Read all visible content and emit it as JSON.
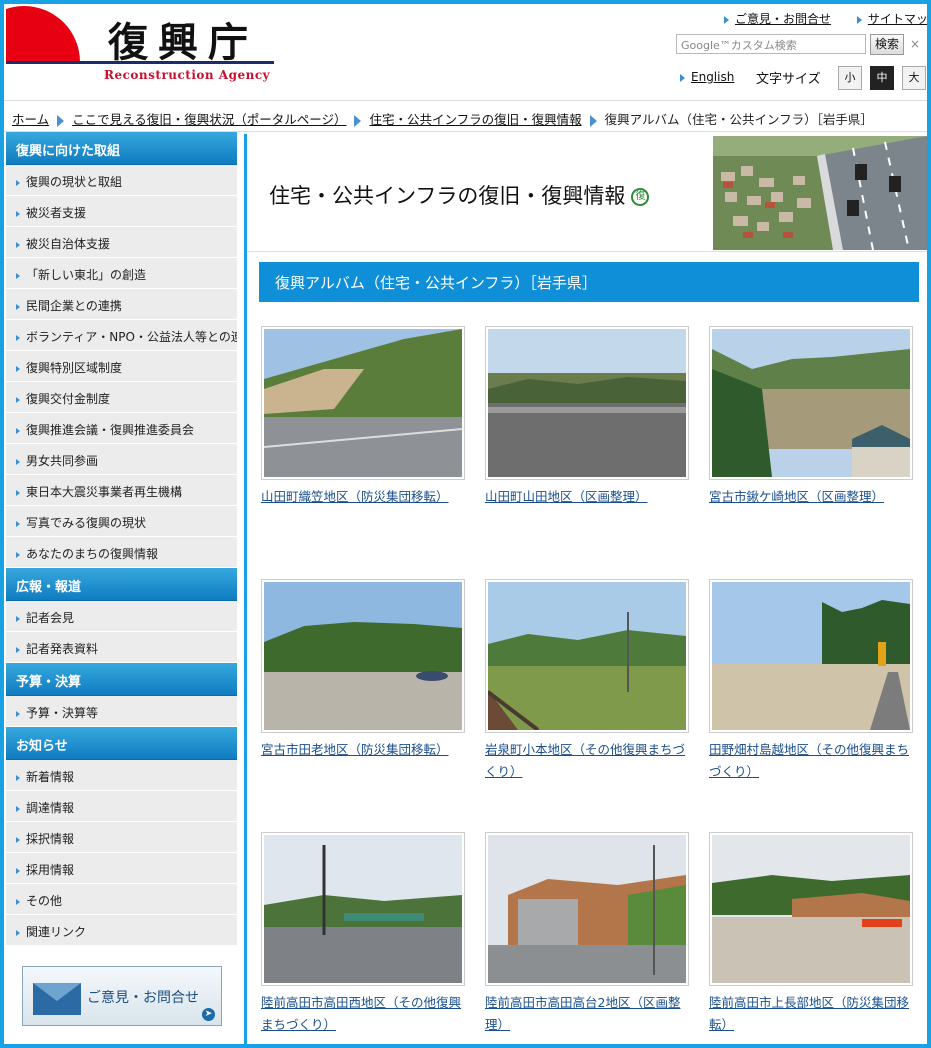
{
  "header": {
    "logo_text": "復興庁",
    "logo_en": "Reconstruction Agency",
    "util_links": [
      "ご意見・お問合せ",
      "サイトマップ"
    ],
    "search": {
      "placeholder": "Google™カスタム検索",
      "button": "検索",
      "clear": "×"
    },
    "english": "English",
    "size_label": "文字サイズ",
    "sizes": [
      "小",
      "中",
      "大"
    ],
    "active_size": "中"
  },
  "breadcrumb": [
    "ホーム",
    "ここで見える復旧・復興状況（ポータルページ）",
    "住宅・公共インフラの復旧・復興情報",
    "復興アルバム（住宅・公共インフラ）［岩手県］"
  ],
  "sidebar": {
    "sections": [
      {
        "title": "復興に向けた取組",
        "items": [
          "復興の現状と取組",
          "被災者支援",
          "被災自治体支援",
          "「新しい東北」の創造",
          "民間企業との連携",
          "ボランティア・NPO・公益法人等との連携",
          "復興特別区域制度",
          "復興交付金制度",
          "復興推進会議・復興推進委員会",
          "男女共同参画",
          "東日本大震災事業者再生機構",
          "写真でみる復興の現状",
          "あなたのまちの復興情報"
        ]
      },
      {
        "title": "広報・報道",
        "items": [
          "記者会見",
          "記者発表資料"
        ]
      },
      {
        "title": "予算・決算",
        "items": [
          "予算・決算等"
        ]
      },
      {
        "title": "お知らせ",
        "items": [
          "新着情報",
          "調達情報",
          "採択情報",
          "採用情報",
          "その他",
          "関連リンク"
        ]
      }
    ],
    "contact": "ご意見・お問合せ"
  },
  "main": {
    "banner_title": "住宅・公共インフラの復旧・復興情報",
    "banner_badge": "復",
    "section_title": "復興アルバム（住宅・公共インフラ）［岩手県］",
    "album": [
      "山田町織笠地区（防災集団移転）",
      "山田町山田地区（区画整理）",
      "宮古市鍬ケ崎地区（区画整理）",
      "宮古市田老地区（防災集団移転）",
      "岩泉町小本地区（その他復興まちづくり）",
      "田野畑村島越地区（その他復興まちづくり）",
      "陸前高田市高田西地区（その他復興まちづくり）",
      "陸前高田市高田高台2地区（区画整理）",
      "陸前高田市上長部地区（防災集団移転）"
    ]
  }
}
